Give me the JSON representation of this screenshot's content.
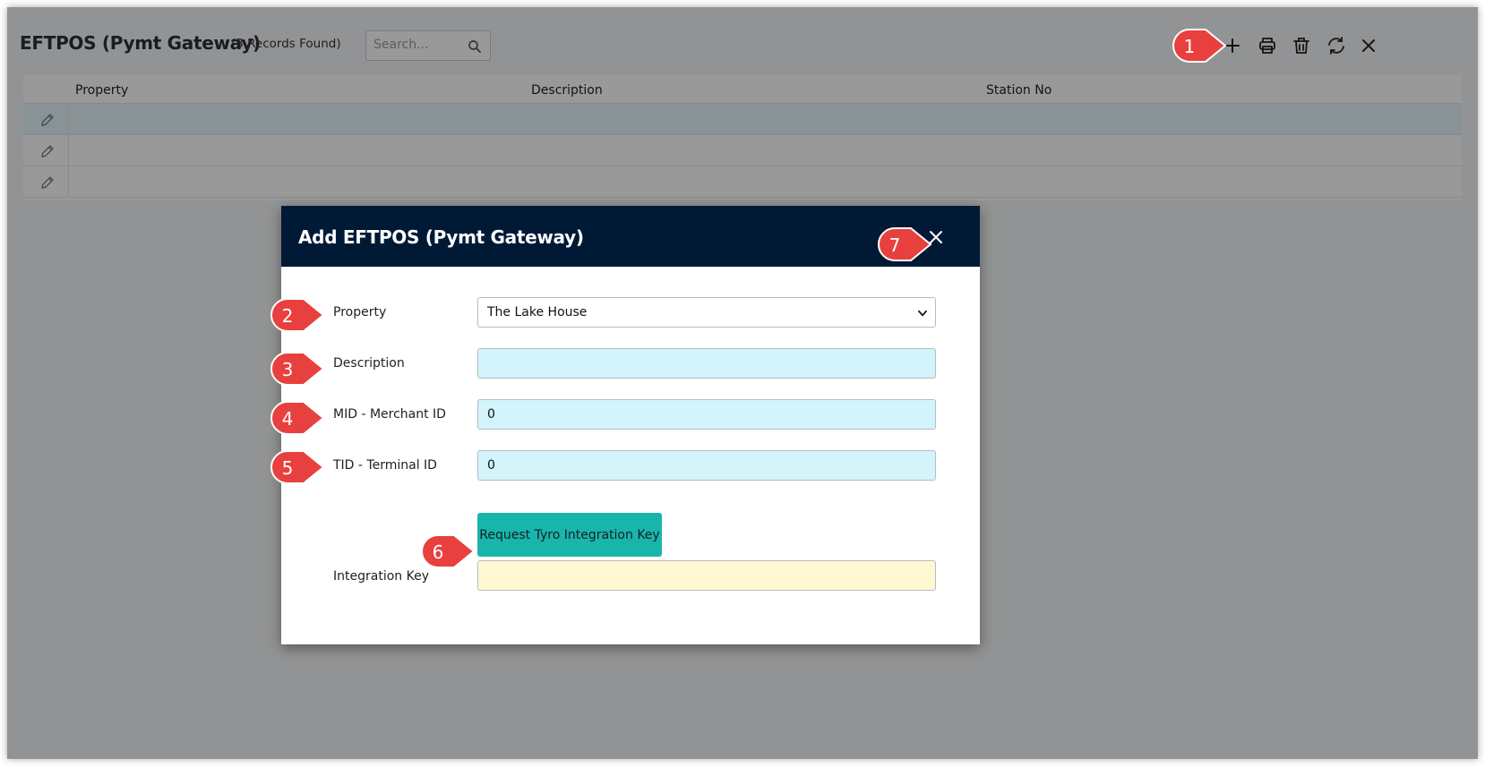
{
  "toolbar": {
    "title": "EFTPOS (Pymt Gateway)",
    "records_found": "(3 Records Found)",
    "search_placeholder": "Search..."
  },
  "grid": {
    "columns": [
      "Property",
      "Description",
      "Station No"
    ],
    "row_count": 3
  },
  "modal": {
    "title": "Add EFTPOS (Pymt Gateway)",
    "fields": {
      "property_label": "Property",
      "property_value": "The Lake House",
      "property_options": [
        "The Lake House"
      ],
      "description_label": "Description",
      "description_value": "",
      "mid_label": "MID - Merchant ID",
      "mid_value": "0",
      "tid_label": "TID - Terminal ID",
      "tid_value": "0",
      "integration_key_label": "Integration Key",
      "integration_key_value": ""
    },
    "request_button_label": "Request Tyro Integration Key"
  },
  "callouts": [
    "1",
    "2",
    "3",
    "4",
    "5",
    "6",
    "7"
  ],
  "colors": {
    "modal_header": "#001a36",
    "accent_button": "#1ab5aa",
    "callout": "#e8403f",
    "input_cyan": "#d2f4fa",
    "input_yellow": "#fef9d3"
  }
}
